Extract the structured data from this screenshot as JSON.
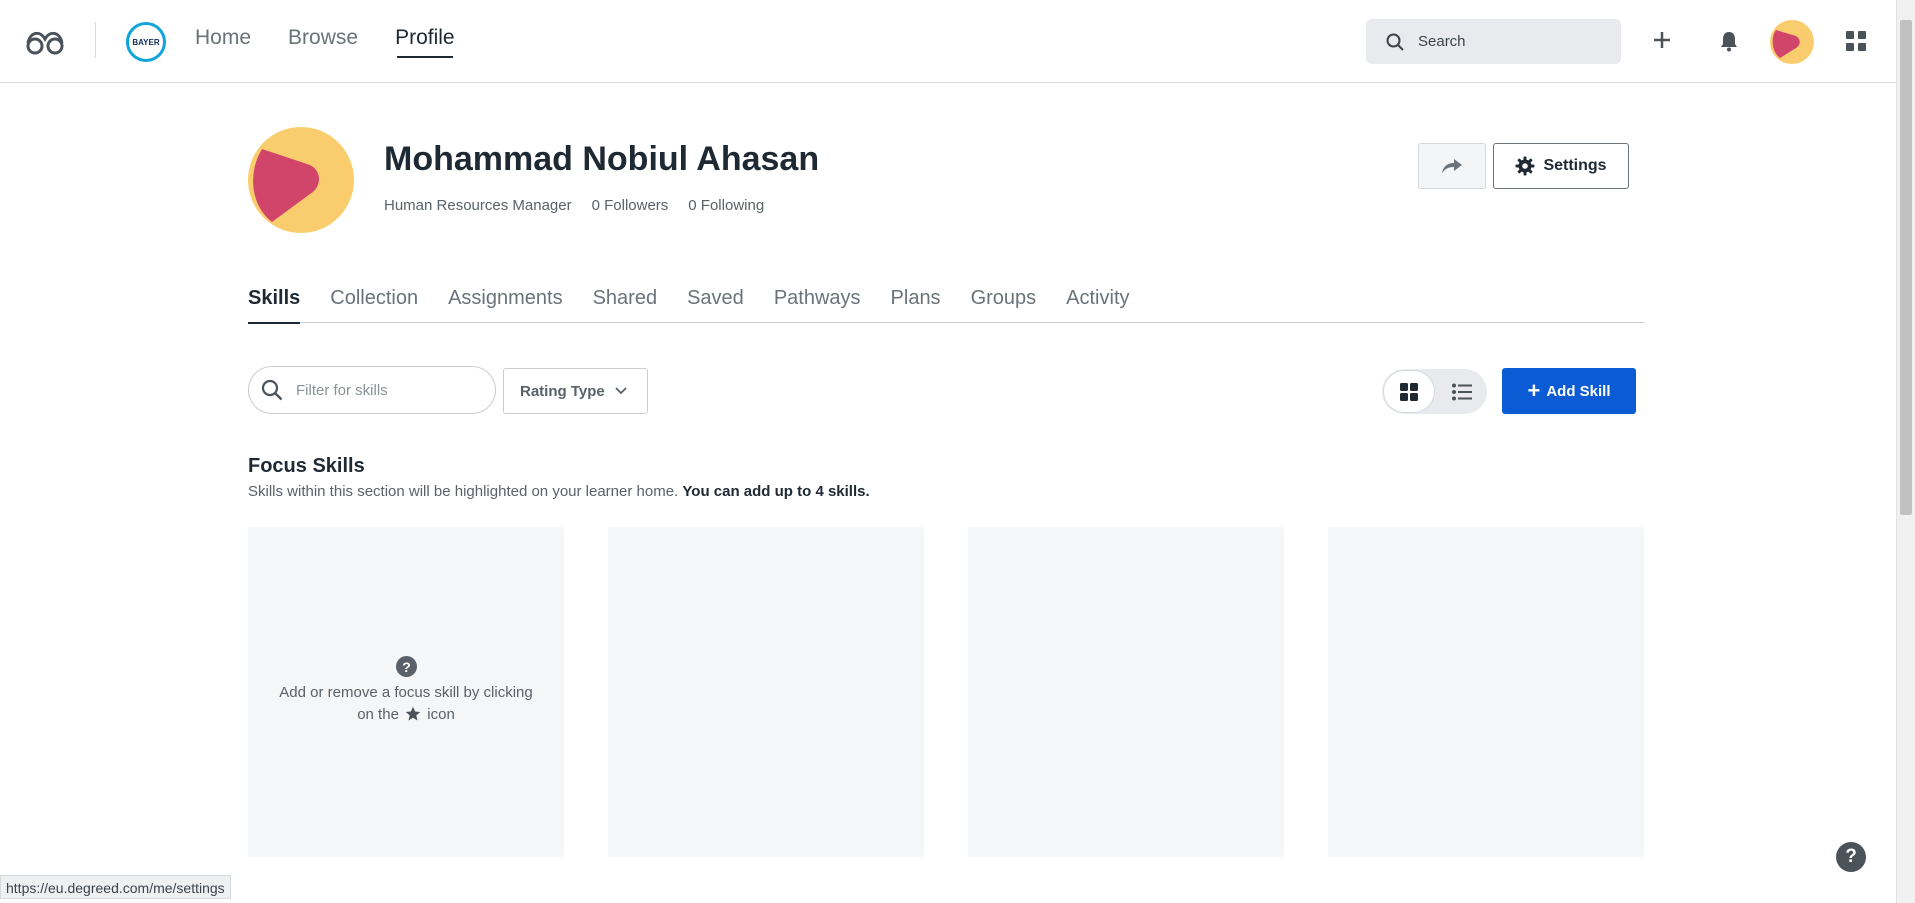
{
  "nav": {
    "links": [
      "Home",
      "Browse",
      "Profile"
    ],
    "active": "Profile",
    "search_placeholder": "Search",
    "logo_text": "BAYER"
  },
  "profile": {
    "name": "Mohammad Nobiul Ahasan",
    "title": "Human Resources Manager",
    "followers": "0 Followers",
    "following": "0 Following",
    "settings_label": "Settings"
  },
  "tabs": [
    "Skills",
    "Collection",
    "Assignments",
    "Shared",
    "Saved",
    "Pathways",
    "Plans",
    "Groups",
    "Activity"
  ],
  "filters": {
    "filter_placeholder": "Filter for skills",
    "rating_type_label": "Rating Type",
    "add_skill_label": "Add Skill"
  },
  "focus": {
    "title": "Focus Skills",
    "description": "Skills within this section will be highlighted on your learner home.",
    "description_bold": "You can add up to 4 skills.",
    "card_hint_before": "Add or remove a focus skill by clicking on the",
    "card_hint_after": "icon"
  },
  "status_url": "https://eu.degreed.com/me/settings",
  "colors": {
    "accent_blue": "#0a5bd4",
    "avatar_pink": "#d2456b",
    "avatar_yellow": "#f9cd6e"
  },
  "icons": [
    "glasses-icon",
    "search-icon",
    "plus-icon",
    "bell-icon",
    "apps-grid-icon",
    "share-arrow-icon",
    "gear-icon",
    "chevron-down-icon",
    "grid-view-icon",
    "list-view-icon",
    "question-icon",
    "star-icon"
  ]
}
